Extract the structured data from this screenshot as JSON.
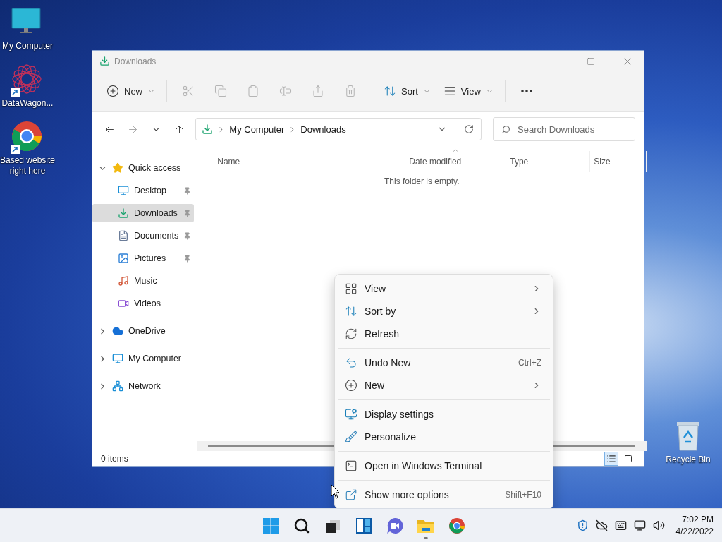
{
  "desktop_icons": [
    {
      "label": "My Computer",
      "kind": "computer",
      "shortcut": false
    },
    {
      "label": "DataWagon...",
      "kind": "app",
      "shortcut": true
    },
    {
      "label": "Based website right here",
      "kind": "browser",
      "shortcut": true
    }
  ],
  "recycle_bin": {
    "label": "Recycle Bin"
  },
  "window": {
    "title": "Downloads",
    "toolbar": [
      {
        "kind": "new",
        "label": "New",
        "dropdown": true,
        "disabled": false
      },
      {
        "kind": "cut",
        "disabled": true
      },
      {
        "kind": "copy",
        "disabled": true
      },
      {
        "kind": "paste",
        "disabled": true
      },
      {
        "kind": "rename",
        "disabled": true
      },
      {
        "kind": "share",
        "disabled": true
      },
      {
        "kind": "delete",
        "disabled": true
      },
      {
        "kind": "sort",
        "label": "Sort",
        "dropdown": true,
        "disabled": false
      },
      {
        "kind": "view",
        "label": "View",
        "dropdown": true,
        "disabled": false
      },
      {
        "kind": "more",
        "disabled": false
      }
    ],
    "nav": {
      "back_disabled": false,
      "forward_disabled": true
    },
    "address": {
      "path": [
        "My Computer",
        "Downloads"
      ]
    },
    "search": {
      "placeholder": "Search Downloads"
    },
    "tree": [
      {
        "label": "Quick access",
        "kind": "star",
        "expanded": true,
        "selected": false,
        "children": [
          {
            "label": "Desktop",
            "kind": "desktop",
            "pinned": true,
            "selected": false
          },
          {
            "label": "Downloads",
            "kind": "downloads",
            "pinned": true,
            "selected": true
          },
          {
            "label": "Documents",
            "kind": "documents",
            "pinned": true,
            "selected": false
          },
          {
            "label": "Pictures",
            "kind": "pictures",
            "pinned": true,
            "selected": false
          },
          {
            "label": "Music",
            "kind": "music",
            "pinned": false,
            "selected": false
          },
          {
            "label": "Videos",
            "kind": "videos",
            "pinned": false,
            "selected": false
          }
        ]
      },
      {
        "label": "OneDrive",
        "kind": "cloud",
        "expanded": false,
        "selected": false
      },
      {
        "label": "My Computer",
        "kind": "computer",
        "expanded": false,
        "selected": false
      },
      {
        "label": "Network",
        "kind": "network",
        "expanded": false,
        "selected": false
      }
    ],
    "columns": [
      {
        "label": "Name",
        "sorted": false
      },
      {
        "label": "Date modified",
        "sorted": true
      },
      {
        "label": "Type",
        "sorted": false
      },
      {
        "label": "Size",
        "sorted": false
      }
    ],
    "empty_message": "This folder is empty.",
    "status": "0 items",
    "view_modes": [
      {
        "kind": "details",
        "selected": true
      },
      {
        "kind": "tiles",
        "selected": false
      }
    ]
  },
  "context_menu": {
    "groups": [
      {
        "items": [
          {
            "kind": "view",
            "label": "View",
            "submenu": true
          },
          {
            "kind": "sort",
            "label": "Sort by",
            "submenu": true
          },
          {
            "kind": "refresh",
            "label": "Refresh",
            "submenu": false
          }
        ]
      },
      {
        "items": [
          {
            "kind": "undo",
            "label": "Undo New",
            "shortcut": "Ctrl+Z",
            "submenu": false
          },
          {
            "kind": "new",
            "label": "New",
            "submenu": true
          }
        ]
      },
      {
        "items": [
          {
            "kind": "display",
            "label": "Display settings",
            "submenu": false
          },
          {
            "kind": "personalize",
            "label": "Personalize",
            "submenu": false
          }
        ]
      },
      {
        "items": [
          {
            "kind": "terminal",
            "label": "Open in Windows Terminal",
            "submenu": false
          }
        ]
      },
      {
        "items": [
          {
            "kind": "more",
            "label": "Show more options",
            "shortcut": "Shift+F10",
            "submenu": false
          }
        ]
      }
    ]
  },
  "taskbar": {
    "apps": [
      {
        "kind": "start",
        "active": false
      },
      {
        "kind": "search",
        "active": false
      },
      {
        "kind": "taskview",
        "active": false
      },
      {
        "kind": "widgets",
        "active": false
      },
      {
        "kind": "chat",
        "active": false
      },
      {
        "kind": "explorer",
        "active": true
      },
      {
        "kind": "chrome",
        "active": false
      }
    ],
    "time": "7:02 PM",
    "date": "4/22/2022"
  }
}
